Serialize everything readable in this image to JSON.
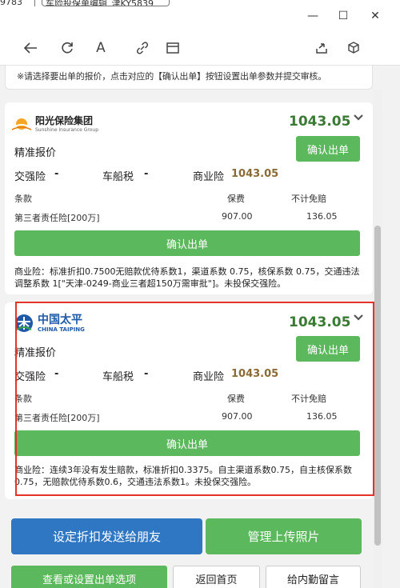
{
  "window": {
    "tab_fragment_1": "9783",
    "tab_fragment_2": "车险投保单编辑_津KY5839",
    "controls": {
      "minimize": "—",
      "maximize": "☐",
      "close": "✕"
    }
  },
  "toolbar": {
    "icons": [
      "back-icon",
      "refresh-icon",
      "font-icon",
      "link-icon",
      "window-icon",
      "share-icon",
      "cube-icon"
    ]
  },
  "notice": "※请选择要出单的报价，点击对应的【确认出单】按钮设置出单参数并提交审核。",
  "quotes": [
    {
      "company_name": "阳光保险集团",
      "company_name_en": "Sunshine Insurance Group",
      "total": "1043.05",
      "quote_type": "精准报价",
      "confirm_label": "确认出单",
      "jiaoqiang_label": "交强险",
      "jiaoqiang_value": "-",
      "chechuan_label": "车船税",
      "chechuan_value": "-",
      "commercial_label": "商业险",
      "commercial_value": "1043.05",
      "col_clause": "条款",
      "col_premium": "保费",
      "col_deductible": "不计免赔",
      "rows": [
        {
          "clause": "第三者责任险[200万]",
          "premium": "907.00",
          "deductible": "136.05"
        }
      ],
      "wide_button": "确认出单",
      "description": "商业险：标准折扣0.7500无赔款优待系数1，渠道系数 0.75，核保系数 0.75，交通违法调整系数 1[\"天津-0249-商业三者超150万需审批\"]。未投保交强险。"
    },
    {
      "company_name": "中国太平",
      "company_name_en": "CHINA TAIPING",
      "total": "1043.05",
      "quote_type": "精准报价",
      "confirm_label": "确认出单",
      "jiaoqiang_label": "交强险",
      "jiaoqiang_value": "-",
      "chechuan_label": "车船税",
      "chechuan_value": "-",
      "commercial_label": "商业险",
      "commercial_value": "1043.05",
      "col_clause": "条款",
      "col_premium": "保费",
      "col_deductible": "不计免赔",
      "rows": [
        {
          "clause": "第三者责任险[200万]",
          "premium": "907.00",
          "deductible": "136.05"
        }
      ],
      "wide_button": "确认出单",
      "description": "商业险：连续3年没有发生赔款，标准折扣0.3375。自主渠道系数0.75，自主核保系数0.75，无赔款优待系数0.6，交通违法系数1。未投保交强险。"
    }
  ],
  "actions": {
    "discount_send": "设定折扣发送给朋友",
    "manage_photos": "管理上传照片",
    "view_options": "查看或设置出单选项",
    "back_home": "返回首页",
    "leave_message": "给内勤留言"
  },
  "colors": {
    "green": "#5cb85c",
    "blue": "#2f77c3",
    "price_green": "#3a7a35",
    "highlight_red": "#e5332a"
  }
}
